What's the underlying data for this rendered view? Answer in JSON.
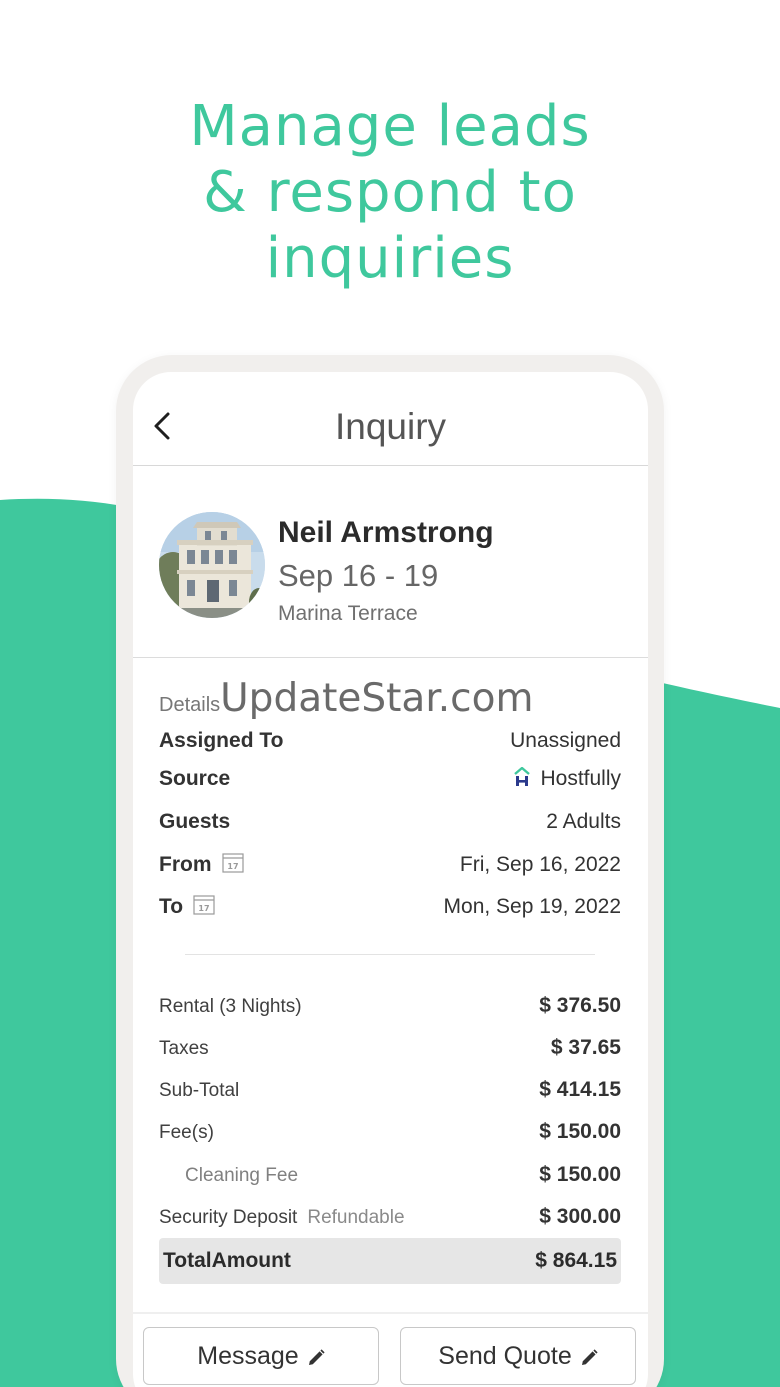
{
  "headline": {
    "line1": "Manage leads",
    "line2": "& respond to",
    "line3": "inquiries"
  },
  "nav": {
    "back_icon": "chevron-left-icon",
    "title": "Inquiry"
  },
  "profile": {
    "guest_name": "Neil Armstrong",
    "stay_dates": "Sep 16 - 19",
    "property_name": "Marina Terrace",
    "avatar": "house-photo"
  },
  "details": {
    "label": "Details",
    "watermark": "UpdateStar.com",
    "rows": [
      {
        "label": "Assigned To",
        "value": "Unassigned"
      },
      {
        "label": "Source",
        "value": "Hostfully",
        "icon": "hostfully-logo-icon"
      },
      {
        "label": "Guests",
        "value": "2 Adults"
      },
      {
        "label": "From",
        "value": "Fri, Sep 16, 2022",
        "icon": "calendar-icon",
        "icon_text": "17"
      },
      {
        "label": "To",
        "value": "Mon, Sep 19, 2022",
        "icon": "calendar-icon",
        "icon_text": "17"
      }
    ]
  },
  "pricing": {
    "rows": [
      {
        "label": "Rental (3 Nights)",
        "value": "$ 376.50"
      },
      {
        "label": "Taxes",
        "value": "$ 37.65"
      },
      {
        "label": "Sub-Total",
        "value": "$ 414.15"
      },
      {
        "label": "Fee(s)",
        "value": "$ 150.00"
      },
      {
        "label": "Cleaning Fee",
        "value": "$ 150.00"
      },
      {
        "label": "Security Deposit",
        "sublabel": "Refundable",
        "value": "$ 300.00"
      }
    ],
    "total_label": "TotalAmount",
    "total_value": "$ 864.15"
  },
  "actions": {
    "message_label": "Message",
    "send_quote_label": "Send Quote",
    "icon": "pencil-icon"
  },
  "colors": {
    "brand_green": "#3fc89d",
    "hostfully_navy": "#2b3a8c"
  }
}
